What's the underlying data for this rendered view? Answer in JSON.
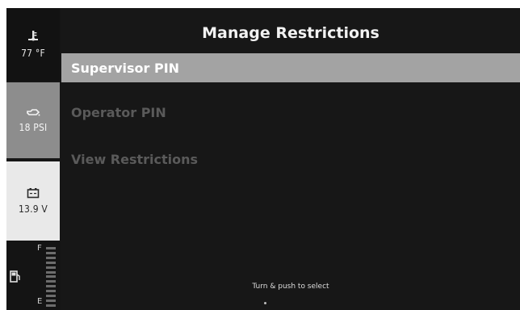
{
  "gauges": {
    "temperature": {
      "icon": "temperature-icon",
      "value": "77 °F"
    },
    "oil_pressure": {
      "icon": "oil-pressure-icon",
      "value": "18 PSI"
    },
    "voltage": {
      "icon": "battery-icon",
      "value": "13.9 V"
    },
    "fuel": {
      "icon": "fuel-icon",
      "full_label": "F",
      "empty_label": "E"
    }
  },
  "screen": {
    "title": "Manage Restrictions",
    "menu": [
      {
        "label": "Supervisor PIN",
        "selected": true
      },
      {
        "label": "Operator PIN",
        "selected": false
      },
      {
        "label": "View Restrictions",
        "selected": false
      }
    ],
    "hint": "Turn & push to select"
  }
}
